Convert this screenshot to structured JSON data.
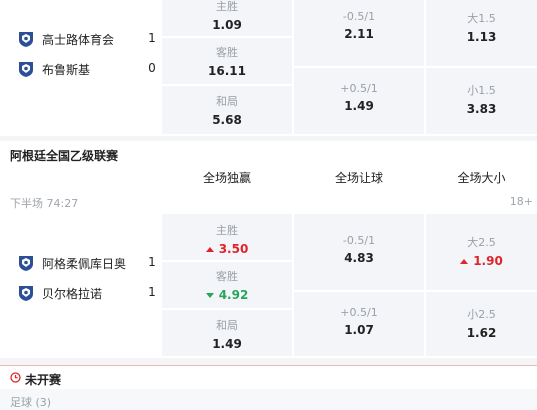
{
  "match1": {
    "home": {
      "name": "高士路体育会",
      "score": "1"
    },
    "away": {
      "name": "布鲁斯基",
      "score": "0"
    },
    "win_home": {
      "label": "主胜",
      "value": "1.09"
    },
    "win_away": {
      "label": "客胜",
      "value": "16.11"
    },
    "draw": {
      "label": "和局",
      "value": "5.68"
    },
    "hcp1": {
      "label": "-0.5/1",
      "value": "2.11"
    },
    "hcp2": {
      "label": "+0.5/1",
      "value": "1.49"
    },
    "ou1": {
      "label": "大1.5",
      "value": "1.13"
    },
    "ou2": {
      "label": "小1.5",
      "value": "3.83"
    }
  },
  "league": {
    "name": "阿根廷全国乙级联赛",
    "col_1x2": "全场独赢",
    "col_handicap": "全场让球",
    "col_ou": "全场大小",
    "period": "下半场 74:27",
    "more": "18+"
  },
  "match2": {
    "home": {
      "name": "阿格柔佩库日奥",
      "score": "1"
    },
    "away": {
      "name": "贝尔格拉诺",
      "score": "1"
    },
    "win_home": {
      "label": "主胜",
      "value": "3.50"
    },
    "win_away": {
      "label": "客胜",
      "value": "4.92"
    },
    "draw": {
      "label": "和局",
      "value": "1.49"
    },
    "hcp1": {
      "label": "-0.5/1",
      "value": "4.83"
    },
    "hcp2": {
      "label": "+0.5/1",
      "value": "1.07"
    },
    "ou1": {
      "label": "大2.5",
      "value": "1.90"
    },
    "ou2": {
      "label": "小2.5",
      "value": "1.62"
    }
  },
  "upcoming": {
    "title": "未开赛",
    "sport": "足球 (3)"
  },
  "colors": {
    "up": "#e0242a",
    "down": "#28a55c",
    "shield": "#2d4f96"
  },
  "icons": [
    "team-shield-icon",
    "arrow-up-icon",
    "arrow-down-icon",
    "clock-icon"
  ]
}
